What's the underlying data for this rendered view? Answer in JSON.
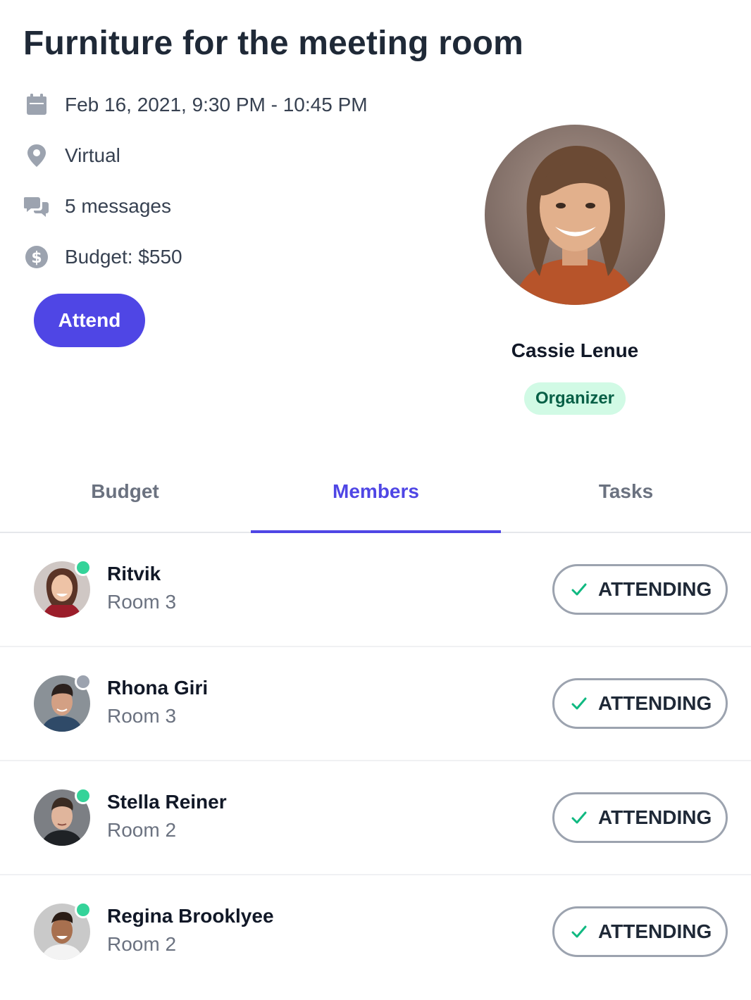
{
  "event": {
    "title": "Furniture for the meeting room",
    "datetime": "Feb 16, 2021, 9:30 PM - 10:45 PM",
    "location": "Virtual",
    "messages": "5 messages",
    "budget": "Budget: $550",
    "attend_label": "Attend"
  },
  "icons": {
    "date": "calendar-icon",
    "location": "location-pin-icon",
    "messages": "chat-bubbles-icon",
    "budget": "dollar-circle-icon",
    "status": "check-icon"
  },
  "organizer": {
    "name": "Cassie Lenue",
    "role": "Organizer"
  },
  "tabs": [
    {
      "label": "Budget",
      "active": false
    },
    {
      "label": "Members",
      "active": true
    },
    {
      "label": "Tasks",
      "active": false
    }
  ],
  "members": [
    {
      "name": "Ritvik",
      "room": "Room 3",
      "status": "ATTENDING",
      "online": true
    },
    {
      "name": "Rhona Giri",
      "room": "Room 3",
      "status": "ATTENDING",
      "online": false
    },
    {
      "name": "Stella Reiner",
      "room": "Room 2",
      "status": "ATTENDING",
      "online": true
    },
    {
      "name": "Regina Brooklyee",
      "room": "Room 2",
      "status": "ATTENDING",
      "online": true
    }
  ],
  "colors": {
    "accent": "#4f46e5",
    "online": "#34d399",
    "offline": "#9ca3af",
    "badge_bg": "#d1fae5",
    "badge_text": "#065f46",
    "check": "#10b981"
  }
}
